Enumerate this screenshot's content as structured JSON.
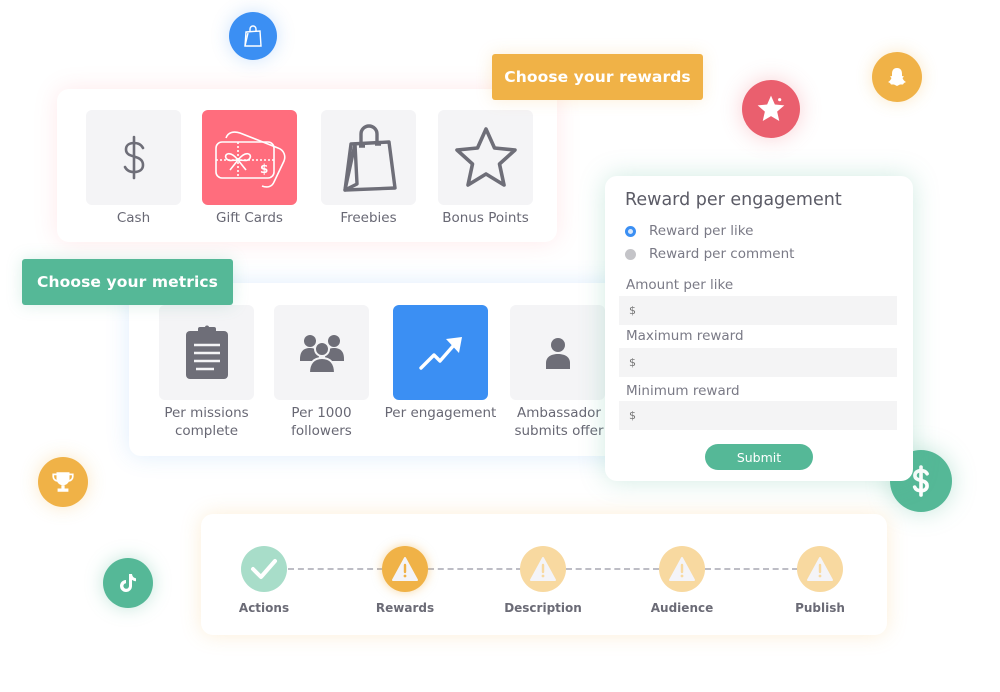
{
  "rewards_section": {
    "tag_label": "Choose your rewards",
    "tag_color": "#f0b247",
    "items": [
      {
        "label": "Cash",
        "icon": "dollar-icon",
        "selected": false
      },
      {
        "label": "Gift Cards",
        "icon": "gift-card-icon",
        "selected": true
      },
      {
        "label": "Freebies",
        "icon": "shopping-bag-icon",
        "selected": false
      },
      {
        "label": "Bonus Points",
        "icon": "star-icon",
        "selected": false
      }
    ],
    "selected_color": "#ff6d7d"
  },
  "metrics_section": {
    "tag_label": "Choose your metrics",
    "tag_color": "#55b897",
    "items": [
      {
        "label_line1": "Per missions",
        "label_line2": "complete",
        "icon": "clipboard-icon",
        "selected": false
      },
      {
        "label_line1": "Per 1000",
        "label_line2": "followers",
        "icon": "group-icon",
        "selected": false
      },
      {
        "label_line1": "Per engagement",
        "label_line2": "",
        "icon": "trending-up-icon",
        "selected": true
      },
      {
        "label_line1": "Ambassador",
        "label_line2": "submits offer",
        "icon": "person-icon",
        "selected": false
      }
    ],
    "selected_color": "#3b8ff3"
  },
  "reward_form": {
    "title": "Reward per engagement",
    "options": [
      {
        "label": "Reward per like",
        "checked": true
      },
      {
        "label": "Reward per comment",
        "checked": false
      }
    ],
    "fields": [
      {
        "label": "Amount per like",
        "placeholder": "$",
        "value": ""
      },
      {
        "label": "Maximum reward",
        "placeholder": "$",
        "value": ""
      },
      {
        "label": "Minimum reward",
        "placeholder": "$",
        "value": ""
      }
    ],
    "submit_label": "Submit"
  },
  "progress_steps": [
    {
      "label": "Actions",
      "status": "complete"
    },
    {
      "label": "Rewards",
      "status": "current-warning"
    },
    {
      "label": "Description",
      "status": "warning"
    },
    {
      "label": "Audience",
      "status": "warning"
    },
    {
      "label": "Publish",
      "status": "warning"
    }
  ],
  "floating_icons": [
    {
      "name": "shopping-bag-badge",
      "color": "#3b8ff3"
    },
    {
      "name": "star-badge",
      "color": "#ea5f6e"
    },
    {
      "name": "snapchat-badge",
      "color": "#f0b247"
    },
    {
      "name": "trophy-badge",
      "color": "#f0b247"
    },
    {
      "name": "tiktok-badge",
      "color": "#55b897"
    },
    {
      "name": "dollar-badge",
      "color": "#55b897"
    }
  ],
  "colors": {
    "complete": "#a8ddc9",
    "current_warning": "#f0b247",
    "warning": "#f8d9a0",
    "icon_gray": "#6e6e78"
  }
}
